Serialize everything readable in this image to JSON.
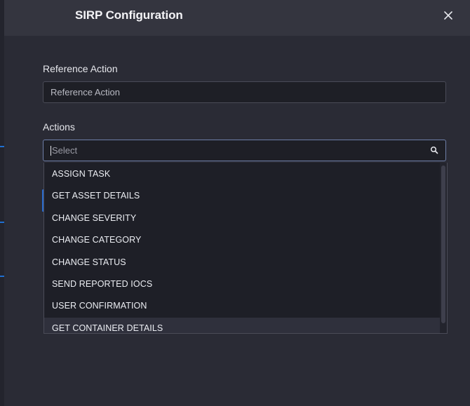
{
  "header": {
    "title": "SIRP Configuration",
    "close_icon": "close-icon"
  },
  "form": {
    "reference_action": {
      "label": "Reference Action",
      "placeholder": "Reference Action"
    },
    "actions": {
      "label": "Actions",
      "placeholder": "Select",
      "search_icon": "search-icon"
    }
  },
  "dropdown": {
    "options": [
      "ASSIGN TASK",
      "GET ASSET DETAILS",
      "CHANGE SEVERITY",
      "CHANGE CATEGORY",
      "CHANGE STATUS",
      "SEND REPORTED IOCS",
      "USER CONFIRMATION",
      "GET CONTAINER DETAILS"
    ],
    "highlighted_option": "GET CONTAINER DETAILS"
  },
  "colors": {
    "background": "#2a2b35",
    "header": "#34353f",
    "input_bg": "#1e1f26",
    "focus_border": "#6e7fa8",
    "accent": "#1f6fd1"
  }
}
